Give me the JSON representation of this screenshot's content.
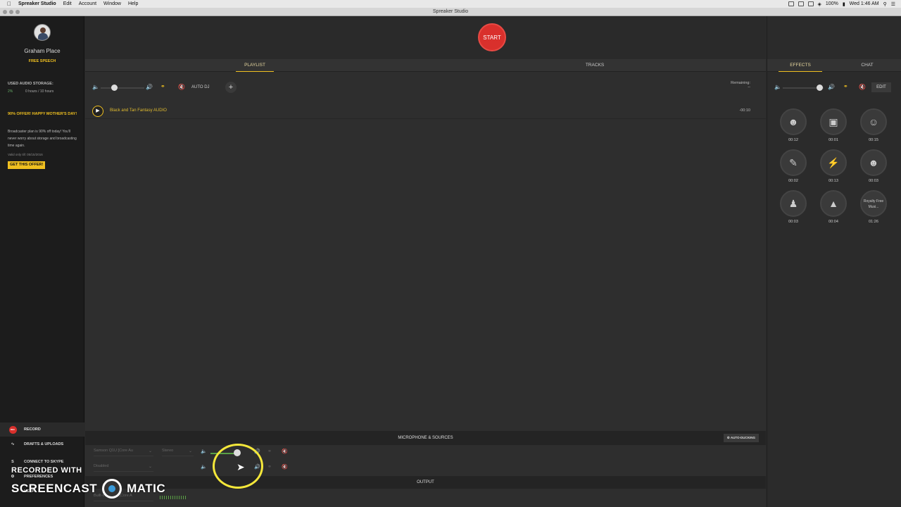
{
  "menubar": {
    "app": "Spreaker Studio",
    "items": [
      "Edit",
      "Account",
      "Window",
      "Help"
    ],
    "battery": "100%",
    "clock": "Wed 1:46 AM"
  },
  "window": {
    "title": "Spreaker Studio"
  },
  "sidebar": {
    "user_name": "Graham Place",
    "plan": "FREE SPEECH",
    "storage_label": "USED AUDIO STORAGE:",
    "storage_pct": "2%",
    "storage_value": "0 hours / 10 hours",
    "offer_title": "90% OFFER! HAPPY MOTHER'S DAY!",
    "offer_text": "Broadcaster plan is 90% off today! You'll never worry about storage and broadcasting time again.",
    "offer_valid": "Valid only till: 05/15/2016",
    "offer_button": "GET THIS OFFER!",
    "nav": {
      "record": "RECORD",
      "record_badge": "REC",
      "drafts": "DRAFTS & UPLOADS",
      "skype": "CONNECT TO SKYPE",
      "preferences": "PREFERENCES",
      "help": "HELP"
    }
  },
  "main": {
    "start_label": "START",
    "tabs": {
      "playlist": "PLAYLIST",
      "tracks": "TRACKS"
    },
    "auto_dj": "AUTO DJ",
    "add_label": "+",
    "remaining_label": "Remaining:",
    "remaining_value": "--",
    "playlist_volume": 0.3,
    "track": {
      "title": "Black and Tan Fantasy AUDIO",
      "time": "-00:10"
    },
    "mic_header": "MICROPHONE & SOURCES",
    "auto_ducking": "AUTO-DUCKING",
    "sources": [
      {
        "device": "Samson Q1U [Core Au",
        "mode": "Stereo"
      },
      {
        "device": "Disabled",
        "mode": ""
      }
    ],
    "source_volume": 0.8,
    "output_header": "OUTPUT",
    "output_device": "Built-in Output [Core A"
  },
  "effects": {
    "tabs": {
      "effects": "EFFECTS",
      "chat": "CHAT"
    },
    "edit": "EDIT",
    "volume": 0.9,
    "items": [
      {
        "icon": "crowd-icon",
        "time": "00:12"
      },
      {
        "icon": "camera-icon",
        "time": "00:01"
      },
      {
        "icon": "faces-icon",
        "time": "00:15"
      },
      {
        "icon": "gun-icon",
        "time": "00:02"
      },
      {
        "icon": "lightning-icon",
        "time": "00:13"
      },
      {
        "icon": "laugh-icon",
        "time": "00:03"
      },
      {
        "icon": "spy-icon",
        "time": "00:03"
      },
      {
        "icon": "bell-icon",
        "time": "00:04"
      },
      {
        "label": "Royalty Free Musi...",
        "time": "01:26"
      }
    ]
  },
  "watermark": {
    "line1": "RECORDED WITH",
    "brand_left": "SCREENCAST",
    "brand_right": "MATIC"
  }
}
